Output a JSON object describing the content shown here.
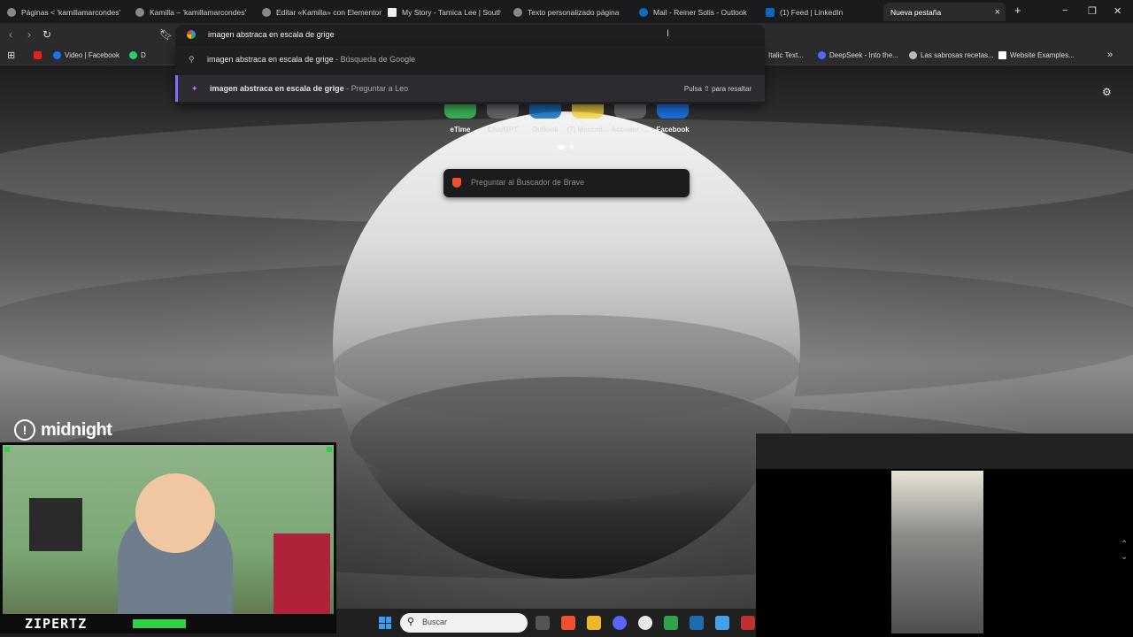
{
  "tabs": [
    {
      "title": "Páginas < 'kamillamarcondes'",
      "active": false
    },
    {
      "title": "Kamilla – 'kamillamarcondes'",
      "active": false
    },
    {
      "title": "Editar «Kamilla» con Elementor",
      "active": false
    },
    {
      "title": "My Story - Tamica Lee | Southe",
      "active": false
    },
    {
      "title": "Texto personalizado página",
      "active": false
    },
    {
      "title": "Mail - Reiner Solis - Outlook",
      "active": false
    },
    {
      "title": "(1) Feed | LinkedIn",
      "active": false
    },
    {
      "title": "Nueva pestaña",
      "active": true
    }
  ],
  "window_controls": {
    "new_tab": "+",
    "minimize": "−",
    "restore": "❐",
    "close": "✕",
    "tab_close": "×"
  },
  "omnibox": {
    "value": "imagen abstraca en escala de grige"
  },
  "suggestions": [
    {
      "text": "imagen abstraca en escala de grige",
      "suffix": "- Búsqueda de Google",
      "hint": ""
    },
    {
      "text": "imagen abstraca en escala de grige",
      "suffix": "- Preguntar a Leo",
      "hint": "Pulsa ⇧ para resaltar"
    }
  ],
  "bookmarks_left": [
    {
      "label": "Video | Facebook",
      "color": "#1877f2"
    },
    {
      "label": "D",
      "color": "#25d366"
    }
  ],
  "bookmarks_right": [
    {
      "label": "Italic Text...",
      "color": "#888888"
    },
    {
      "label": "DeepSeek - Into the...",
      "color": "#4d6bfe"
    },
    {
      "label": "Las sabrosas recetas...",
      "color": "#bbbbbb"
    },
    {
      "label": "Website Examples...",
      "color": "#ffffff"
    }
  ],
  "bookmarks_more": "»",
  "top_sites": [
    {
      "label": "eTime",
      "color": "#3cc45a"
    },
    {
      "label": "ChatGPT",
      "color": "#9a9a9a"
    },
    {
      "label": "Outlook",
      "color": "#0f6cbd"
    },
    {
      "label": "(7) Mercad...",
      "color": "#f7d23b"
    },
    {
      "label": "Acceder -...",
      "color": "#dddddd"
    },
    {
      "label": "Facebook",
      "color": "#1877f2"
    }
  ],
  "brave_search": {
    "placeholder": "Preguntar al Buscador de Brave"
  },
  "overlay": {
    "brand": "midnight",
    "streamer": "ZIPERTZ"
  },
  "taskbar": {
    "search_placeholder": "Buscar"
  },
  "colors": {
    "accent": "#7d6cff",
    "brave": "#f0502d",
    "stream_green": "#32d247"
  }
}
